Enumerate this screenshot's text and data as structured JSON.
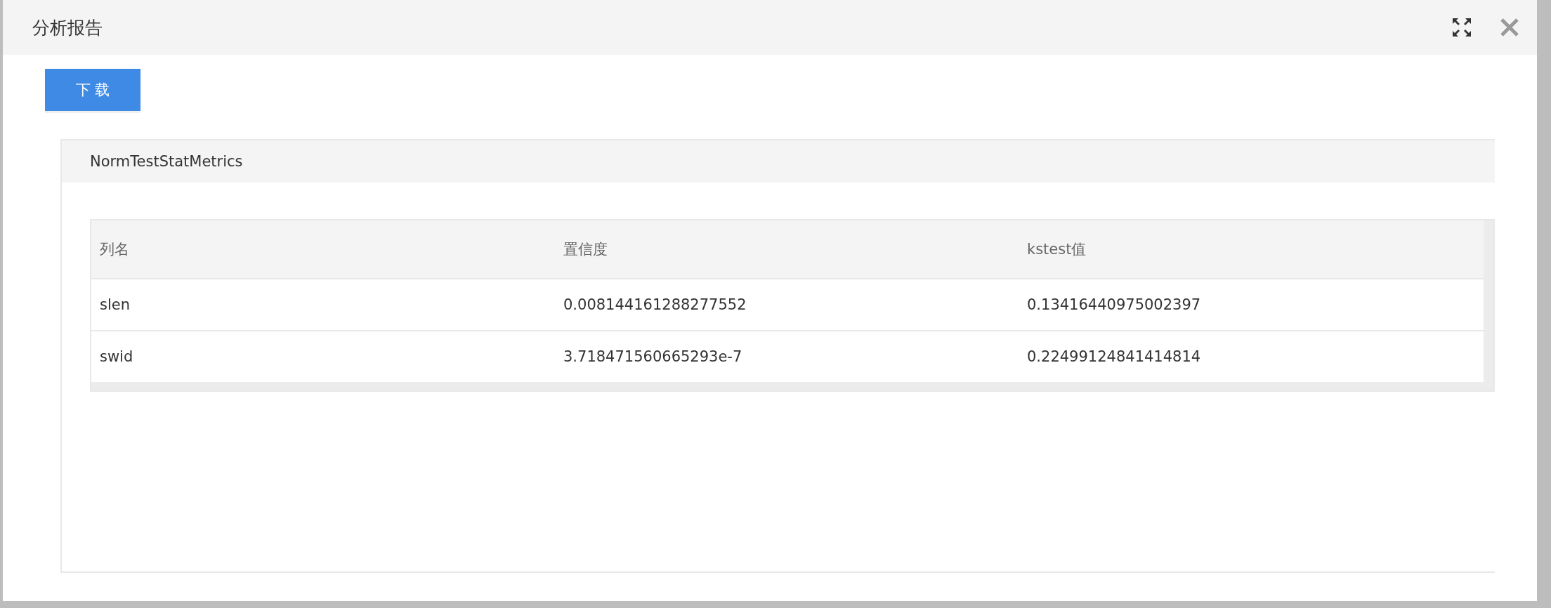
{
  "dialog": {
    "title": "分析报告"
  },
  "download_button": "下 载",
  "panel": {
    "title": "NormTestStatMetrics",
    "table": {
      "columns": [
        "列名",
        "置信度",
        "kstest值"
      ],
      "rows": [
        [
          "slen",
          "0.008144161288277552",
          "0.13416440975002397"
        ],
        [
          "swid",
          "3.718471560665293e-7",
          "0.22499124841414814"
        ]
      ]
    }
  }
}
